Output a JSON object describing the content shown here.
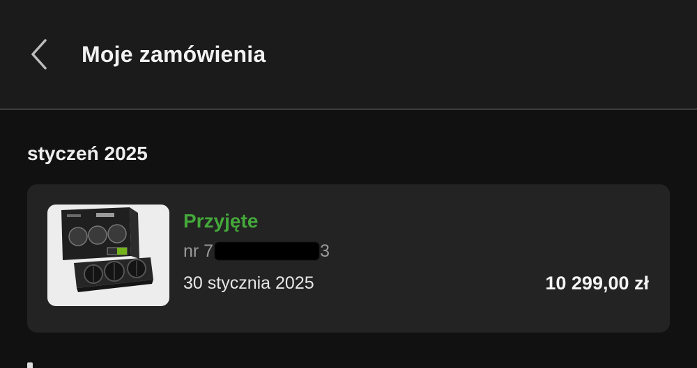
{
  "header": {
    "title": "Moje zamówienia",
    "back_icon": "chevron-left-icon"
  },
  "orders_section": {
    "month_heading": "styczeń 2025",
    "orders": [
      {
        "status": "Przyjęte",
        "status_color": "#44a83a",
        "number_prefix": "nr 7",
        "number_suffix": "3",
        "date": "30 stycznia 2025",
        "price": "10 299,00 zł",
        "thumbnail_icon": "graphics-card-box-image"
      }
    ]
  }
}
